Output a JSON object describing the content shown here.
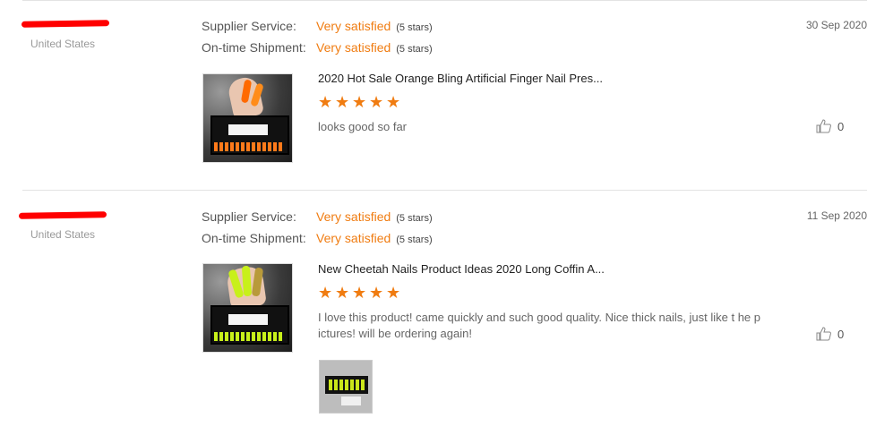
{
  "colors": {
    "accent": "#f07c11",
    "redaction": "#ff0000",
    "muted": "#999999"
  },
  "reviews": [
    {
      "country": "United States",
      "supplier_label": "Supplier Service:",
      "supplier_value": "Very satisfied",
      "supplier_count": "(5 stars)",
      "shipment_label": "On-time Shipment:",
      "shipment_value": "Very satisfied",
      "shipment_count": "(5 stars)",
      "date": "30 Sep 2020",
      "product_title": "2020 Hot Sale Orange Bling Artificial Finger Nail Pres...",
      "rating": 5,
      "comment": "looks good so far",
      "likes": "0",
      "product_image_icon": "nail-box-orange-image"
    },
    {
      "country": "United States",
      "supplier_label": "Supplier Service:",
      "supplier_value": "Very satisfied",
      "supplier_count": "(5 stars)",
      "shipment_label": "On-time Shipment:",
      "shipment_value": "Very satisfied",
      "shipment_count": "(5 stars)",
      "date": "11 Sep 2020",
      "product_title": "New Cheetah Nails Product Ideas 2020 Long Coffin A...",
      "rating": 5,
      "comment": "I love this product! came quickly and such good quality. Nice thick nails, just like t he pictures! will be ordering again!",
      "likes": "0",
      "product_image_icon": "nail-box-neon-image",
      "attachment_icon": "customer-photo-image"
    }
  ]
}
